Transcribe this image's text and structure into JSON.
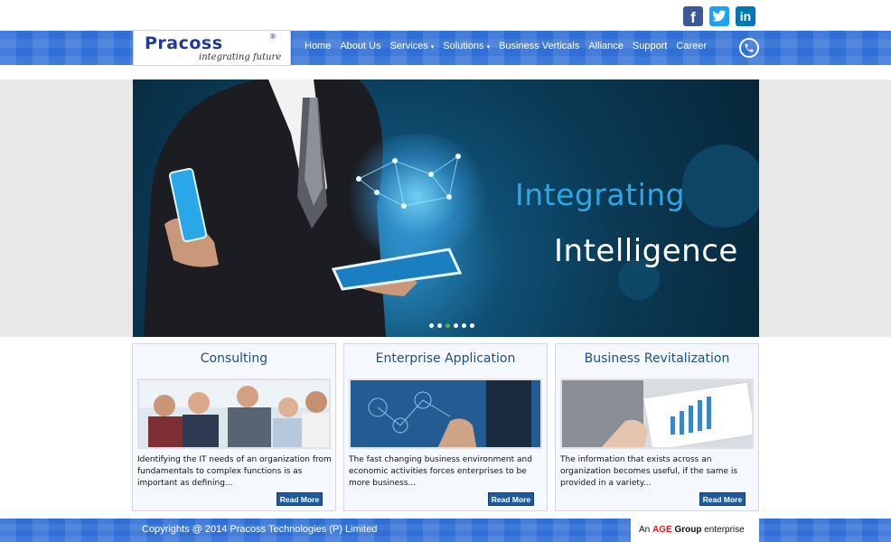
{
  "social": {
    "facebook": {
      "icon": "facebook-icon",
      "glyph": "f",
      "color": "#3b5998"
    },
    "twitter": {
      "icon": "twitter-icon",
      "color": "#1da1f2"
    },
    "linkedin": {
      "icon": "linkedin-icon",
      "glyph": "in",
      "color": "#0077b5"
    }
  },
  "brand": {
    "name": "Pracoss",
    "registered": "®",
    "tagline": "integrating future",
    "color": "#1f3b93"
  },
  "nav": {
    "items": [
      {
        "label": "Home"
      },
      {
        "label": "About Us"
      },
      {
        "label": "Services",
        "caret": "▾"
      },
      {
        "label": "Solutions",
        "caret": "▾"
      },
      {
        "label": "Business Verticals"
      },
      {
        "label": "Alliance"
      },
      {
        "label": "Support"
      },
      {
        "label": "Career"
      }
    ],
    "phone_icon": "phone-icon",
    "band_color": "#2f6fd6"
  },
  "hero": {
    "line1": "Integrating",
    "line2": "Intelligence",
    "line1_color": "#2fa6e6",
    "line2_color": "#ffffff",
    "slides_total": 6,
    "slide_active": 3
  },
  "cards": [
    {
      "title": "Consulting",
      "image": "consulting-team-photo",
      "text": "Identifying the IT needs of an organization from fundamentals to complex functions is as important as defining...",
      "button": "Read More"
    },
    {
      "title": "Enterprise Application",
      "image": "enterprise-touchscreen-photo",
      "text": "The fast changing business environment and economic activities forces enterprises to be more business...",
      "button": "Read More"
    },
    {
      "title": "Business Revitalization",
      "image": "business-tablet-chart-photo",
      "text": "The information that exists across an organization becomes useful, if the same is provided in a variety...",
      "button": "Read More"
    }
  ],
  "footer": {
    "copyright": "Copyrights @ 2014 Pracoss Technologies (P) Limited",
    "enterprise_prefix": "An",
    "enterprise_age": "AGE",
    "enterprise_group": "Group",
    "enterprise_suffix": "enterprise",
    "age_color": "#e32020"
  }
}
